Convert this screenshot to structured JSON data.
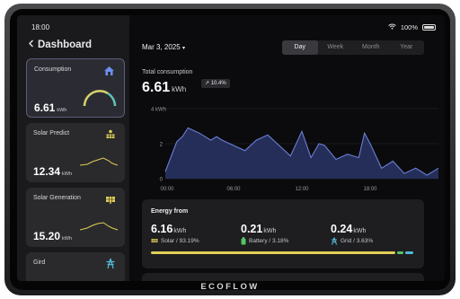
{
  "status": {
    "time": "18:00",
    "battery": "100%"
  },
  "sidebar": {
    "title": "Dashboard",
    "cards": [
      {
        "title": "Consumption",
        "value": "6.61",
        "unit": "kWh"
      },
      {
        "title": "Solar Predict",
        "value": "12.34",
        "unit": "kWh"
      },
      {
        "title": "Solar Generation",
        "value": "15.20",
        "unit": "kWh"
      },
      {
        "title": "Gird"
      }
    ]
  },
  "header": {
    "date": "Mar 3, 2025",
    "tabs": [
      "Day",
      "Week",
      "Month",
      "Year"
    ],
    "active_tab": "Day"
  },
  "total": {
    "label": "Total consumption",
    "value": "6.61",
    "unit": "kWh",
    "change": "↗ 10.4%"
  },
  "chart_data": {
    "type": "area",
    "ylabel": "4 kWh",
    "y_ticks": [
      "4 kWh",
      "2",
      "0"
    ],
    "ylim": [
      0,
      4
    ],
    "x_ticks": [
      "00:00",
      "06:00",
      "12:00",
      "18:00"
    ],
    "x_hours": [
      0,
      1,
      1.5,
      2,
      3,
      4,
      4.5,
      5,
      6,
      7,
      8,
      9,
      10,
      11,
      12,
      12.8,
      13.5,
      14,
      15,
      16,
      17,
      17.5,
      18,
      19,
      20,
      21,
      22,
      23,
      24
    ],
    "values": [
      0.4,
      2.1,
      2.4,
      2.9,
      2.6,
      2.2,
      2.4,
      2.2,
      1.9,
      1.6,
      2.2,
      2.5,
      1.9,
      1.3,
      2.7,
      1.2,
      2.0,
      1.9,
      1.1,
      1.4,
      1.2,
      2.6,
      2.0,
      0.6,
      1.0,
      0.3,
      0.6,
      0.2,
      0.6
    ],
    "grid": true,
    "color": "#6b7fd6"
  },
  "energy": {
    "title": "Energy from",
    "sources": [
      {
        "value": "6.16",
        "unit": "kWh",
        "label": "Solar / 93.19%",
        "icon": "solar-panel-icon",
        "share": 0.9319,
        "color": "#e0cf55"
      },
      {
        "value": "0.21",
        "unit": "kWh",
        "label": "Battery / 3.18%",
        "icon": "battery-icon",
        "share": 0.0318,
        "color": "#58c464"
      },
      {
        "value": "0.24",
        "unit": "kWh",
        "label": "Grid / 3.63%",
        "icon": "grid-tower-icon",
        "share": 0.0363,
        "color": "#52b8d8"
      }
    ]
  },
  "brand": "ECOFLOW"
}
